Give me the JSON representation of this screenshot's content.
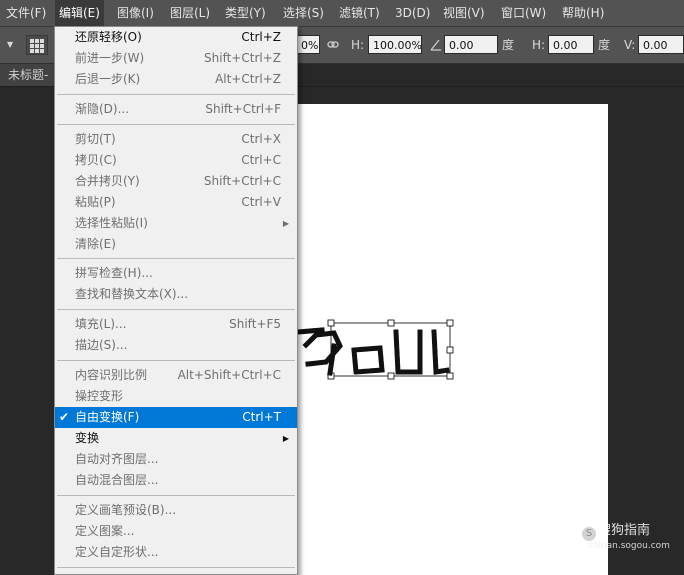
{
  "menubar": {
    "file": "文件(F)",
    "edit": "编辑(E)",
    "image": "图像(I)",
    "layer": "图层(L)",
    "type": "类型(Y)",
    "select": "选择(S)",
    "filter": "滤镜(T)",
    "threed": "3D(D)",
    "view": "视图(V)",
    "window": "窗口(W)",
    "help": "帮助(H)"
  },
  "options": {
    "width_value": "0%",
    "height_label": "H:",
    "height_value": "100.00%",
    "rotate_value": "0.00",
    "rotate_unit": "度",
    "hskew_label": "H:",
    "hskew_value": "0.00",
    "hskew_unit": "度",
    "vskew_label": "V:",
    "vskew_value": "0.00"
  },
  "document": {
    "tab_title": "未标题-"
  },
  "edit_menu": {
    "undo": {
      "label": "还原轻移(O)",
      "shortcut": "Ctrl+Z"
    },
    "step_forward": {
      "label": "前进一步(W)",
      "shortcut": "Shift+Ctrl+Z"
    },
    "step_backward": {
      "label": "后退一步(K)",
      "shortcut": "Alt+Ctrl+Z"
    },
    "fade": {
      "label": "渐隐(D)...",
      "shortcut": "Shift+Ctrl+F"
    },
    "cut": {
      "label": "剪切(T)",
      "shortcut": "Ctrl+X"
    },
    "copy": {
      "label": "拷贝(C)",
      "shortcut": "Ctrl+C"
    },
    "copy_merged": {
      "label": "合并拷贝(Y)",
      "shortcut": "Shift+Ctrl+C"
    },
    "paste": {
      "label": "粘贴(P)",
      "shortcut": "Ctrl+V"
    },
    "paste_special": {
      "label": "选择性粘贴(I)"
    },
    "clear": {
      "label": "清除(E)"
    },
    "spell_check": {
      "label": "拼写检查(H)..."
    },
    "find_replace": {
      "label": "查找和替换文本(X)..."
    },
    "fill": {
      "label": "填充(L)...",
      "shortcut": "Shift+F5"
    },
    "stroke": {
      "label": "描边(S)..."
    },
    "content_aware_scale": {
      "label": "内容识别比例",
      "shortcut": "Alt+Shift+Ctrl+C"
    },
    "puppet_warp": {
      "label": "操控变形"
    },
    "free_transform": {
      "label": "自由变换(F)",
      "shortcut": "Ctrl+T"
    },
    "transform": {
      "label": "变换"
    },
    "auto_align": {
      "label": "自动对齐图层..."
    },
    "auto_blend": {
      "label": "自动混合图层..."
    },
    "define_brush": {
      "label": "定义画笔预设(B)..."
    },
    "define_pattern": {
      "label": "定义图案..."
    },
    "define_shape": {
      "label": "定义自定形状..."
    }
  },
  "watermark": {
    "brand": "搜狗指南",
    "url": "zhinan.sogou.com"
  },
  "colors": {
    "highlight": "#0078d7",
    "menu_bg": "#f0f0f0",
    "chrome": "#535353"
  }
}
